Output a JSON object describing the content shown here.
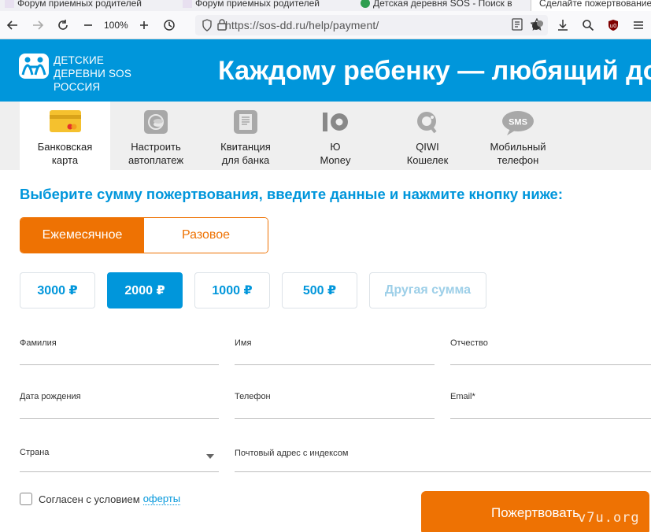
{
  "browser": {
    "tabs": [
      {
        "title": "Форум приемных родителей",
        "icon": "forum-favicon"
      },
      {
        "title": "Форум приемных родителей",
        "icon": "forum-favicon"
      },
      {
        "title": "Детская деревня SOS - Поиск в",
        "icon": "search-favicon"
      },
      {
        "title": "Сделайте пожертвование",
        "icon": "sos-favicon"
      }
    ],
    "zoom": "100%",
    "url": "https://sos-dd.ru/help/payment/"
  },
  "header": {
    "logo_lines": [
      "ДЕТСКИЕ",
      "ДЕРЕВНИ SOS",
      "РОССИЯ"
    ],
    "slogan": "Каждому ребенку — любящий дом"
  },
  "methods": [
    {
      "line1": "Банковская",
      "line2": "карта",
      "icon": "bank-card-icon"
    },
    {
      "line1": "Настроить",
      "line2": "автоплатеж",
      "icon": "autopay-icon"
    },
    {
      "line1": "Квитанция",
      "line2": "для банка",
      "icon": "receipt-icon"
    },
    {
      "line1": "Ю",
      "line2": "Money",
      "icon": "yumoney-icon"
    },
    {
      "line1": "QIWI",
      "line2": "Кошелек",
      "icon": "qiwi-icon"
    },
    {
      "line1": "Мобильный",
      "line2": "телефон",
      "icon": "sms-icon"
    }
  ],
  "headline": "Выберите сумму пожертвования, введите данные и нажмите кнопку ниже:",
  "frequency": {
    "monthly": "Ежемесячное",
    "once": "Разовое",
    "selected": "monthly"
  },
  "amounts": [
    "3000 ₽",
    "2000 ₽",
    "1000 ₽",
    "500 ₽",
    "Другая сумма"
  ],
  "amount_selected": "2000 ₽",
  "form": {
    "last_name": "Фамилия",
    "first_name": "Имя",
    "patronymic": "Отчество",
    "birth_date": "Дата рождения",
    "phone": "Телефон",
    "email": "Email*",
    "country": "Страна",
    "address": "Почтовый адрес с индексом"
  },
  "agree": {
    "text": "Согласен с условием",
    "link": "оферты"
  },
  "donate_button": "Пожертвовать",
  "watermark": "v7u.org",
  "colors": {
    "brand_blue": "#0096db",
    "accent_orange": "#ee7203"
  }
}
